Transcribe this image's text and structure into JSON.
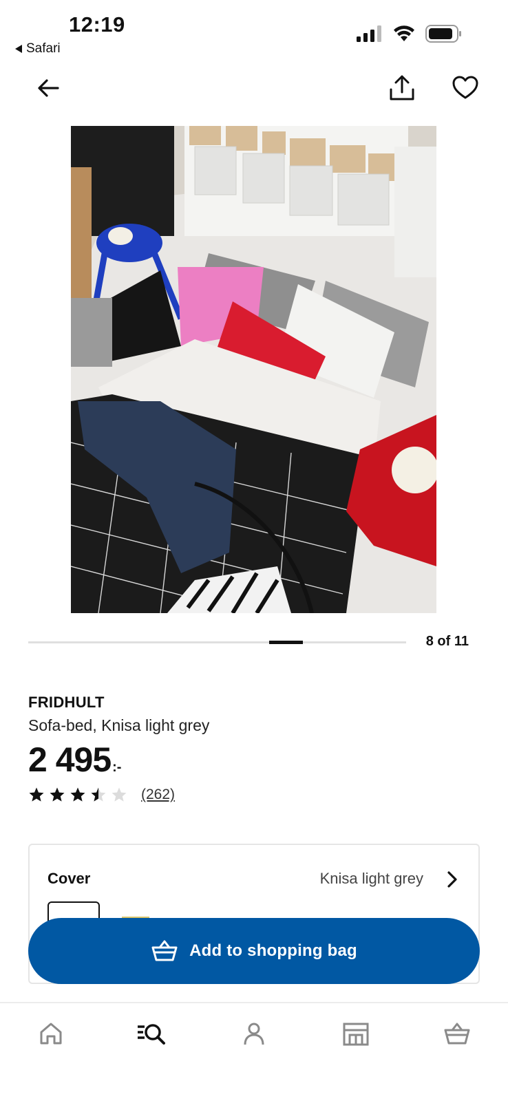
{
  "status_bar": {
    "time": "12:19",
    "back_app": "Safari"
  },
  "nav": {
    "back_icon": "arrow-left-icon",
    "share_icon": "share-icon",
    "favorite_icon": "heart-icon"
  },
  "carousel": {
    "counter": "8 of 11",
    "current": 8,
    "total": 11
  },
  "product": {
    "name": "FRIDHULT",
    "description": "Sofa-bed, Knisa light grey",
    "price": "2 495",
    "price_suffix": ":-",
    "rating": 3.5,
    "rating_max": 5,
    "review_count": "(262)"
  },
  "cover": {
    "label": "Cover",
    "value": "Knisa light grey"
  },
  "add_to_bag": {
    "label": "Add to shopping bag",
    "icon": "shopping-bag-icon"
  },
  "tabbar": {
    "items": [
      "home-icon",
      "search-icon",
      "profile-icon",
      "store-icon",
      "bag-icon"
    ],
    "active": "search-icon"
  },
  "colors": {
    "primary_button": "#0158a3",
    "text": "#111111",
    "border": "#e5e5e5"
  }
}
